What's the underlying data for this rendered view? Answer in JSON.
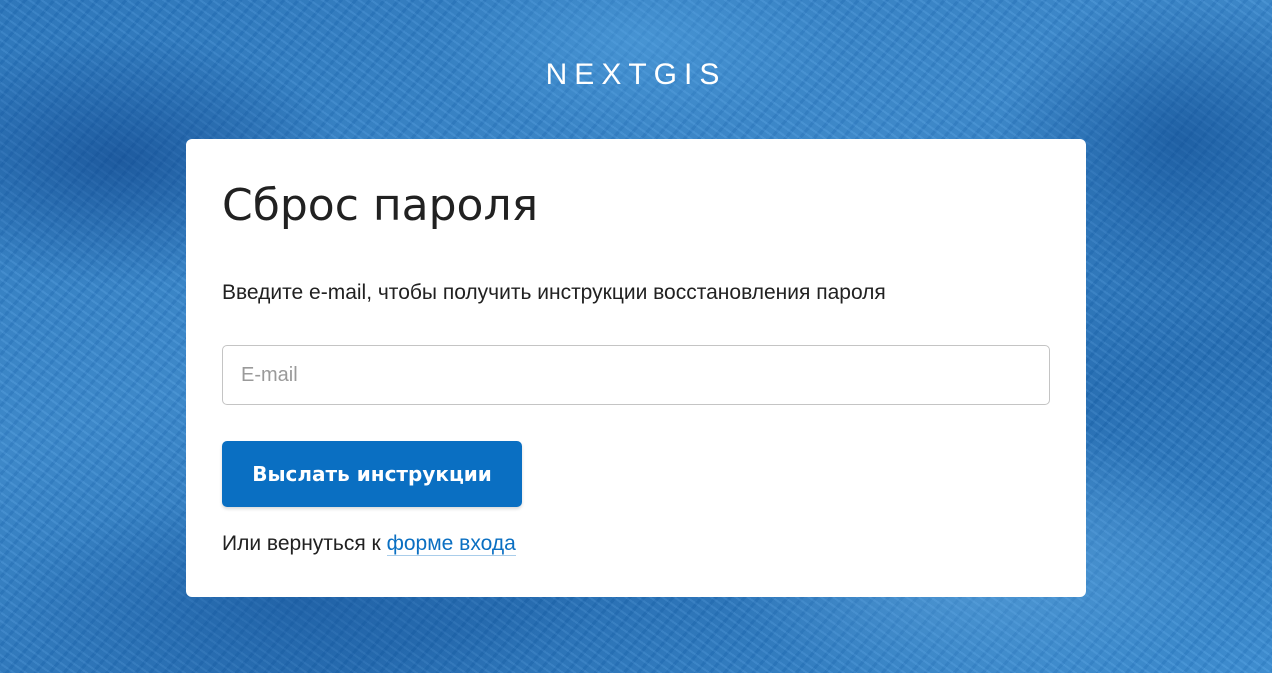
{
  "brand": {
    "logo_text": "NEXTGIS"
  },
  "form": {
    "title": "Сброс пароля",
    "subtitle": "Введите e-mail, чтобы получить инструкции восстановления пароля",
    "email_placeholder": "E-mail",
    "email_value": "",
    "submit_label": "Выслать инструкции",
    "back_prefix": "Или вернуться к",
    "back_link_label": "форме входа"
  },
  "colors": {
    "primary": "#0a6fc2",
    "text": "#212121",
    "card_background": "#ffffff",
    "page_background": "#2f7fc6"
  }
}
